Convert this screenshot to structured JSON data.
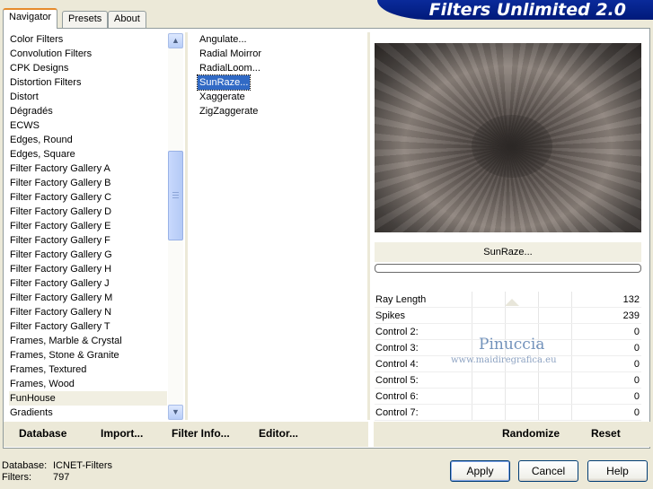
{
  "tabs": [
    "Navigator",
    "Presets",
    "About"
  ],
  "title": "Filters Unlimited 2.0",
  "categories": [
    "Color Filters",
    "Convolution Filters",
    "CPK Designs",
    "Distortion Filters",
    "Distort",
    "Dégradés",
    "ECWS",
    "Edges, Round",
    "Edges, Square",
    "Filter Factory Gallery A",
    "Filter Factory Gallery B",
    "Filter Factory Gallery C",
    "Filter Factory Gallery D",
    "Filter Factory Gallery E",
    "Filter Factory Gallery F",
    "Filter Factory Gallery G",
    "Filter Factory Gallery H",
    "Filter Factory Gallery J",
    "Filter Factory Gallery M",
    "Filter Factory Gallery N",
    "Filter Factory Gallery T",
    "Frames, Marble & Crystal",
    "Frames, Stone & Granite",
    "Frames, Textured",
    "Frames, Wood",
    "FunHouse",
    "Gradients"
  ],
  "selected_category": "FunHouse",
  "filters": [
    "Angulate...",
    "Radial Moirror",
    "RadialLoom...",
    "SunRaze...",
    "Xaggerate",
    "ZigZaggerate"
  ],
  "selected_filter": "SunRaze...",
  "filter_name": "SunRaze...",
  "controls": [
    {
      "label": "Ray Length",
      "value": "132"
    },
    {
      "label": "Spikes",
      "value": "239"
    },
    {
      "label": "Control 2:",
      "value": "0"
    },
    {
      "label": "Control 3:",
      "value": "0"
    },
    {
      "label": "Control 4:",
      "value": "0"
    },
    {
      "label": "Control 5:",
      "value": "0"
    },
    {
      "label": "Control 6:",
      "value": "0"
    },
    {
      "label": "Control 7:",
      "value": "0"
    }
  ],
  "watermark": {
    "line1": "Pinuccia",
    "line2": "www.maidiregrafica.eu"
  },
  "left_links": [
    "Database",
    "Import...",
    "Filter Info...",
    "Editor..."
  ],
  "right_links": [
    "Randomize",
    "Reset"
  ],
  "status": {
    "database_label": "Database:",
    "database_value": "ICNET-Filters",
    "filters_label": "Filters:",
    "filters_value": "797"
  },
  "buttons": {
    "apply": "Apply",
    "cancel": "Cancel",
    "help": "Help"
  }
}
